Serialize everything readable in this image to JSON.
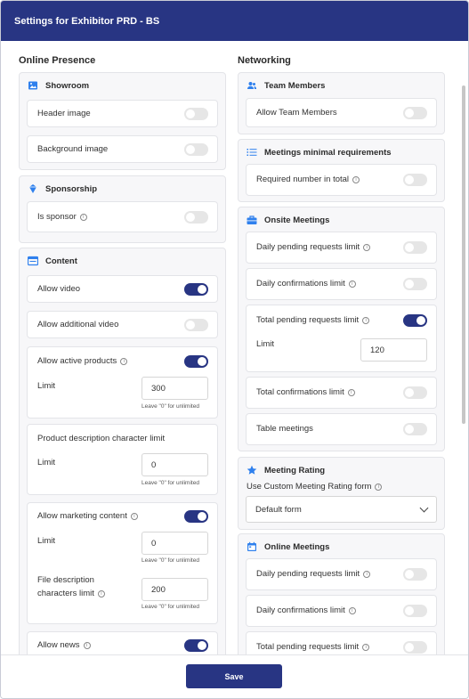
{
  "header": {
    "title": "Settings for Exhibitor PRD - BS"
  },
  "left": {
    "title": "Online Presence",
    "showroom": {
      "title": "Showroom",
      "header_image": "Header image",
      "background_image": "Background image"
    },
    "sponsorship": {
      "title": "Sponsorship",
      "is_sponsor": "Is sponsor"
    },
    "content": {
      "title": "Content",
      "allow_video": "Allow video",
      "allow_additional_video": "Allow additional video",
      "allow_active_products": "Allow active products",
      "limit": "Limit",
      "active_products_limit": "300",
      "hint": "Leave \"0\" for unlimited",
      "product_desc_title": "Product description character limit",
      "product_desc_limit": "0",
      "allow_marketing": "Allow marketing content",
      "marketing_limit": "0",
      "file_desc_label_1": "File description",
      "file_desc_label_2": "characters limit",
      "file_desc_limit": "200",
      "allow_news": "Allow news"
    }
  },
  "right": {
    "title": "Networking",
    "team": {
      "title": "Team Members",
      "allow": "Allow Team Members"
    },
    "meetings_min": {
      "title": "Meetings minimal requirements",
      "required_total": "Required number in total"
    },
    "onsite": {
      "title": "Onsite Meetings",
      "daily_pending": "Daily pending requests limit",
      "daily_confirm": "Daily confirmations limit",
      "total_pending": "Total pending requests limit",
      "limit": "Limit",
      "total_pending_limit": "120",
      "total_confirm": "Total confirmations limit",
      "table_meetings": "Table meetings"
    },
    "rating": {
      "title": "Meeting Rating",
      "custom_form": "Use Custom Meeting Rating form",
      "selected": "Default form"
    },
    "online": {
      "title": "Online Meetings",
      "daily_pending": "Daily pending requests limit",
      "daily_confirm": "Daily confirmations limit",
      "total_pending": "Total pending requests limit"
    }
  },
  "footer": {
    "save": "Save"
  },
  "colors": {
    "primary": "#283583",
    "toggle_off": "#e6e6e6",
    "icon_blue": "#2f80ed"
  }
}
